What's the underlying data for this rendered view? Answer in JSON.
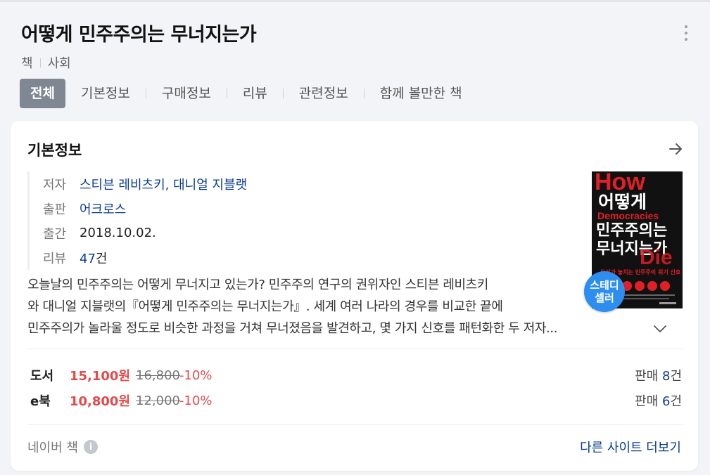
{
  "header": {
    "title": "어떻게 민주주의는 무너지는가",
    "category": [
      "책",
      "사회"
    ]
  },
  "tabs": [
    {
      "label": "전체",
      "active": true
    },
    {
      "label": "기본정보"
    },
    {
      "label": "구매정보"
    },
    {
      "label": "리뷰"
    },
    {
      "label": "관련정보"
    },
    {
      "label": "함께 볼만한 책"
    }
  ],
  "card": {
    "title": "기본정보",
    "info": {
      "author_label": "저자",
      "author": "스티븐 레비츠키, 대니얼 지블랫",
      "publisher_label": "출판",
      "publisher": "어크로스",
      "date_label": "출간",
      "date": "2018.10.02.",
      "review_label": "리뷰",
      "review_count": "47",
      "review_unit": "건"
    },
    "cover": {
      "big_text": "How",
      "title_line1": "어떻게",
      "sub_text": "Democracies",
      "title_line2": "민주주의는",
      "title_line3": "무너지는가",
      "die_text": "Die",
      "tagline": "우리가 놓치는 민주주의 위기 신호"
    },
    "badge": [
      "스테디",
      "셀러"
    ],
    "description": [
      "오늘날의 민주주의는 어떻게 무너지고 있는가? 민주주의 연구의 권위자인 스티븐 레비츠키",
      "와 대니얼 지블랫의『어떻게 민주주의는 무너지는가』. 세계 여러 나라의 경우를 비교한 끝에",
      "민주주의가 놀라울 정도로 비슷한 과정을 거쳐 무너졌음을 발견하고, 몇 가지 신호를 패턴화한 두 저자..."
    ],
    "prices": [
      {
        "type": "도서",
        "price": "15,100원",
        "original": "16,800",
        "discount": "-10%",
        "sold_label": "판매",
        "sold_count": "8",
        "sold_unit": "건"
      },
      {
        "type": "e북",
        "price": "10,800원",
        "original": "12,000",
        "discount": "-10%",
        "sold_label": "판매",
        "sold_count": "6",
        "sold_unit": "건"
      }
    ],
    "footer": {
      "source": "네이버 책",
      "info_icon": "i",
      "more_link": "다른 사이트 더보기"
    }
  },
  "colors": {
    "accent_blue": "#0a3d91",
    "price_red": "#e24b4b",
    "badge_blue": "#2d8ef0",
    "tab_active_bg": "#7f8792",
    "cover_red": "#e21f26"
  },
  "icons": {
    "more": "more-vertical-icon",
    "arrow": "arrow-right-icon",
    "expand": "chevron-down-icon",
    "info": "info-icon"
  }
}
